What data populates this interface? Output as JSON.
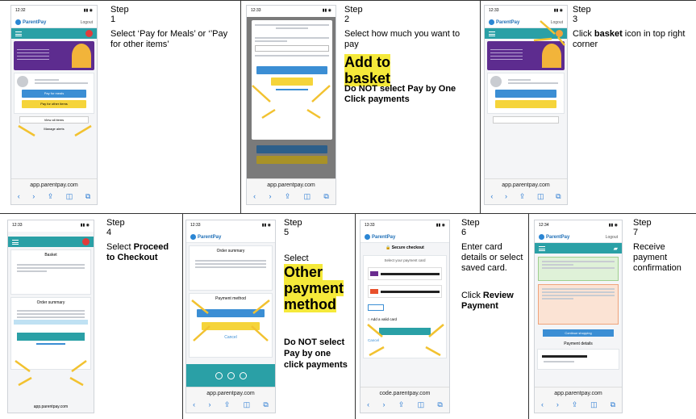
{
  "steps": [
    {
      "title": "Step 1",
      "text1": "Select ‘Pay for Meals’ or ‘’Pay for other items’",
      "phone": {
        "status_time": "12:32",
        "logo": "ParentPay",
        "logout": "Logout",
        "url": "app.parentpay.com",
        "btn1": "Pay for meals",
        "btn2": "Pay for other items",
        "btn3": "View all items",
        "btn4": "Manage alerts"
      }
    },
    {
      "title": "Step 2",
      "text1": "Select how much you want to pay",
      "highlight": "Add to basket",
      "bold": "Do NOT select Pay by One Click payments",
      "phone": {
        "status_time": "12:33",
        "url": "app.parentpay.com"
      }
    },
    {
      "title": "Step 3",
      "text_pre": "Click ",
      "text_bold": "basket",
      "text_post": " icon in top right corner",
      "phone": {
        "status_time": "12:33",
        "logo": "ParentPay",
        "logout": "Logout",
        "url": "app.parentpay.com"
      }
    },
    {
      "title": "Step 4",
      "text_pre": "Select ",
      "text_bold": "Proceed to Checkout",
      "phone": {
        "status_time": "12:33",
        "heading": "Basket",
        "summary": "Order summary",
        "url": "app.parentpay.com"
      }
    },
    {
      "title": "Step 5",
      "text_pre": "Select",
      "highlight": "Other payment method",
      "bold": "Do NOT select Pay by one click payments",
      "phone": {
        "status_time": "12:33",
        "logo": "ParentPay",
        "heading": "Order summary",
        "method": "Payment method",
        "cancel": "Cancel",
        "url": "app.parentpay.com"
      }
    },
    {
      "title": "Step 6",
      "text1": "Enter card details or select saved card.",
      "text_pre": "Click ",
      "text_bold": "Review Payment",
      "phone": {
        "status_time": "13:33",
        "logo": "ParentPay",
        "heading": "Secure checkout",
        "sub": "Select your payment card",
        "add": "Add a valid card",
        "cancel": "Cancel",
        "url": "code.parentpay.com"
      }
    },
    {
      "title": "Step 7",
      "text1": "Receive payment confirmation",
      "phone": {
        "status_time": "12:34",
        "logo": "ParentPay",
        "logout": "Logout",
        "details": "Payment details",
        "continue": "Continue shopping",
        "url": "app.parentpay.com"
      }
    }
  ],
  "colors": {
    "parentpay_teal": "#2aa0a6",
    "button_blue": "#3b8ed4",
    "button_yellow": "#f5d43a",
    "highlight": "#f5e93a",
    "arrow": "#f2c230"
  }
}
